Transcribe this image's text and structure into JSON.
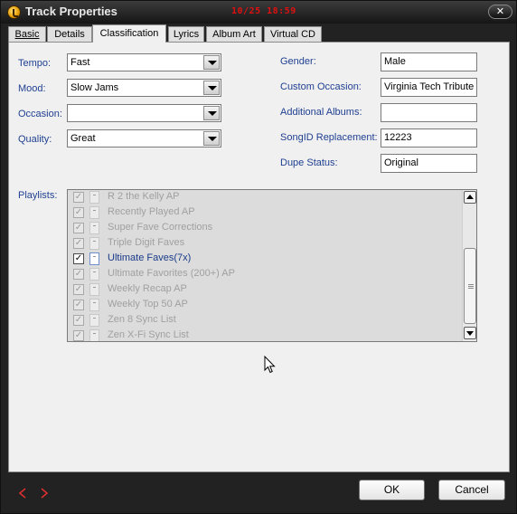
{
  "window": {
    "title": "Track Properties",
    "clock": "10/25  18:59",
    "close_symbol": "✕"
  },
  "tabs": [
    {
      "label": "Basic",
      "active": false
    },
    {
      "label": "Details",
      "active": false
    },
    {
      "label": "Classification",
      "active": true
    },
    {
      "label": "Lyrics",
      "active": false
    },
    {
      "label": "Album Art",
      "active": false
    },
    {
      "label": "Virtual CD",
      "active": false
    }
  ],
  "left_fields": {
    "tempo": {
      "label": "Tempo:",
      "value": "Fast"
    },
    "mood": {
      "label": "Mood:",
      "value": "Slow Jams"
    },
    "occasion": {
      "label": "Occasion:",
      "value": ""
    },
    "quality": {
      "label": "Quality:",
      "value": "Great"
    }
  },
  "right_fields": {
    "gender": {
      "label": "Gender:",
      "value": "Male"
    },
    "custom_occasion": {
      "label": "Custom Occasion:",
      "value": "Virginia Tech Tribute"
    },
    "additional_albums": {
      "label": "Additional Albums:",
      "value": ""
    },
    "songid_replacement": {
      "label": "SongID Replacement:",
      "value": "12223"
    },
    "dupe_status": {
      "label": "Dupe Status:",
      "value": "Original"
    }
  },
  "playlists": {
    "label": "Playlists:",
    "items": [
      {
        "name": "R 2 the Kelly AP",
        "checked": true,
        "enabled": false
      },
      {
        "name": "Recently Played AP",
        "checked": true,
        "enabled": false
      },
      {
        "name": "Super Fave Corrections",
        "checked": true,
        "enabled": false
      },
      {
        "name": "Triple Digit Faves",
        "checked": true,
        "enabled": false
      },
      {
        "name": "Ultimate Faves(7x)",
        "checked": true,
        "enabled": true
      },
      {
        "name": "Ultimate Favorites (200+) AP",
        "checked": true,
        "enabled": false
      },
      {
        "name": "Weekly Recap AP",
        "checked": true,
        "enabled": false
      },
      {
        "name": "Weekly Top 50 AP",
        "checked": true,
        "enabled": false
      },
      {
        "name": "Zen 8 Sync List",
        "checked": true,
        "enabled": false
      },
      {
        "name": "Zen X-Fi Sync List",
        "checked": true,
        "enabled": false
      }
    ]
  },
  "footer": {
    "ok_label": "OK",
    "cancel_label": "Cancel"
  },
  "colors": {
    "label_blue": "#1f3f91",
    "nav_arrow_red": "#d93030",
    "clock_red": "#e01010"
  }
}
